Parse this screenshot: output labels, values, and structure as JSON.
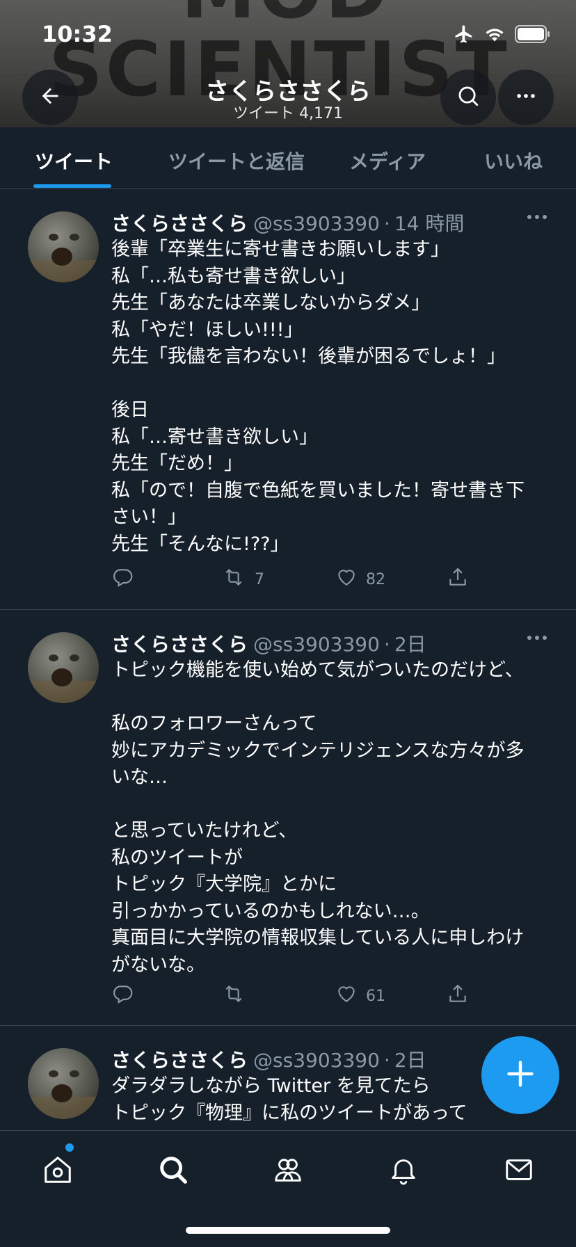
{
  "status_bar": {
    "time": "10:32"
  },
  "header": {
    "banner_line1": "MOD",
    "banner_line2": "SCIENTIST",
    "profile_name": "さくらささくら",
    "tweet_count": "ツイート 4,171"
  },
  "tabs": [
    {
      "label": "ツイート",
      "active": true
    },
    {
      "label": "ツイートと返信",
      "active": false
    },
    {
      "label": "メディア",
      "active": false
    },
    {
      "label": "いいね",
      "active": false
    }
  ],
  "tweets": [
    {
      "name": "さくらささくら",
      "handle": "@ss3903390",
      "time": "14 時間",
      "text": "後輩「卒業生に寄せ書きお願いします」\n私「…私も寄せ書き欲しい」\n先生「あなたは卒業しないからダメ」\n私「やだ！ほしい!!!」\n先生「我儘を言わない！後輩が困るでしょ！」\n\n後日\n私「…寄せ書き欲しい」\n先生「だめ！」\n私「ので！自腹で色紙を買いました！寄せ書き下\nさい！」\n先生「そんなに!??」",
      "reply_count": "",
      "retweet_count": "7",
      "like_count": "82"
    },
    {
      "name": "さくらささくら",
      "handle": "@ss3903390",
      "time": "2日",
      "text": "トピック機能を使い始めて気がついたのだけど、\n\n私のフォロワーさんって\n妙にアカデミックでインテリジェンスな方々が多\nいな…\n\nと思っていたけれど、\n私のツイートが\nトピック『大学院』とかに\n引っかかっているのかもしれない…。\n真面目に大学院の情報収集している人に申しわけ\nがないな。",
      "reply_count": "",
      "retweet_count": "",
      "like_count": "61"
    },
    {
      "name": "さくらささくら",
      "handle": "@ss3903390",
      "time": "2日",
      "text": "ダラダラしながら Twitter を見てたら\nトピック『物理』に私のツイートがあって"
    }
  ],
  "icons": {
    "back": "back-arrow-icon",
    "search": "search-icon",
    "more": "more-icon",
    "reply": "reply-icon",
    "retweet": "retweet-icon",
    "like": "heart-icon",
    "share": "share-icon",
    "compose": "plus-icon",
    "nav": [
      "home-icon",
      "search-icon",
      "communities-icon",
      "bell-icon",
      "mail-icon"
    ]
  },
  "colors": {
    "accent": "#1d9bf0",
    "background": "#15202b",
    "muted": "#8b98a5",
    "divider": "#38444d"
  }
}
